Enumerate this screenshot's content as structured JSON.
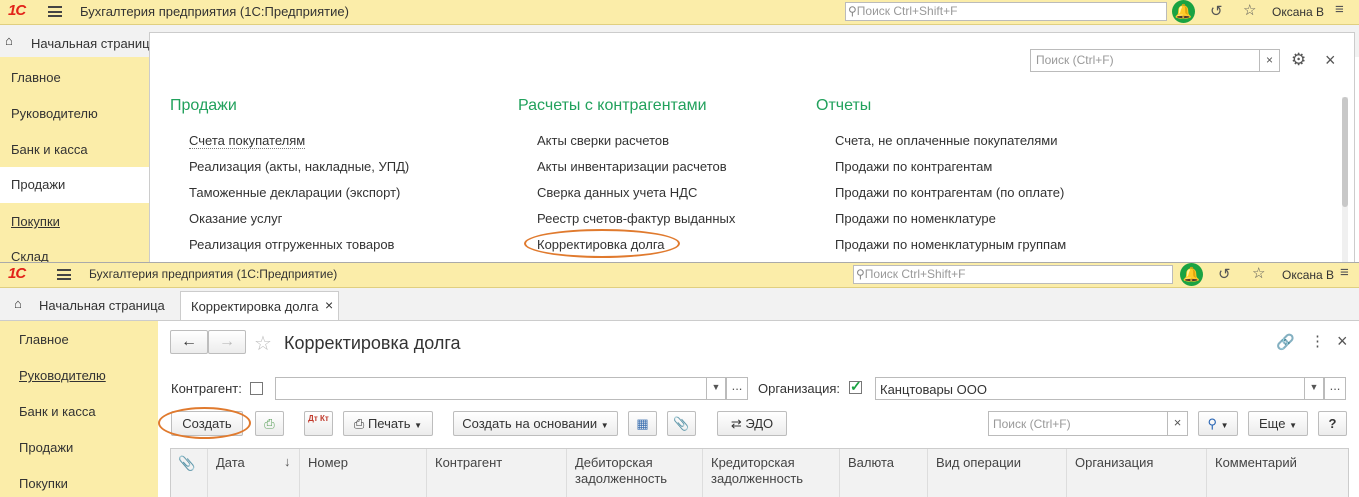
{
  "top": {
    "logo": "1С",
    "title": "Бухгалтерия предприятия  (1С:Предприятие)",
    "search_placeholder": "Поиск Ctrl+Shift+F",
    "user": "Оксана В",
    "home_tab": "Начальная страница",
    "sidebar": [
      "Главное",
      "Руководителю",
      "Банк и касса",
      "Продажи",
      "Покупки",
      "Склад"
    ],
    "panel_search_placeholder": "Поиск (Ctrl+F)",
    "sections": [
      {
        "title": "Продажи",
        "items": [
          "Счета покупателям",
          "Реализация (акты, накладные, УПД)",
          "Таможенные декларации (экспорт)",
          "Оказание услуг",
          "Реализация отгруженных товаров"
        ]
      },
      {
        "title": "Расчеты с контрагентами",
        "items": [
          "Акты сверки расчетов",
          "Акты инвентаризации расчетов",
          "Сверка данных учета НДС",
          "Реестр счетов-фактур выданных",
          "Корректировка долга"
        ]
      },
      {
        "title": "Отчеты",
        "items": [
          "Счета, не оплаченные покупателями",
          "Продажи по контрагентам",
          "Продажи по контрагентам (по оплате)",
          "Продажи по номенклатуре",
          "Продажи по номенклатурным группам"
        ]
      }
    ]
  },
  "bottom": {
    "logo": "1С",
    "title": "Бухгалтерия предприятия  (1С:Предприятие)",
    "search_placeholder": "Поиск Ctrl+Shift+F",
    "user": "Оксана В",
    "home_tab": "Начальная страница",
    "doc_tab": "Корректировка долга",
    "sidebar": [
      "Главное",
      "Руководителю",
      "Банк и касса",
      "Продажи",
      "Покупки"
    ],
    "form_title": "Корректировка долга",
    "contragent_label": "Контрагент:",
    "organization_label": "Организация:",
    "organization_value": "Канцтовары ООО",
    "create_btn": "Создать",
    "dtkt": "Дт Кт",
    "print_btn": "Печать",
    "create_based_btn": "Создать на основании",
    "edo_btn": "ЭДО",
    "search_placeholder_list": "Поиск (Ctrl+F)",
    "more_btn": "Еще",
    "help_btn": "?",
    "columns": [
      {
        "l1": "Дата",
        "l2": ""
      },
      {
        "l1": "Номер",
        "l2": ""
      },
      {
        "l1": "Контрагент",
        "l2": ""
      },
      {
        "l1": "Дебиторская",
        "l2": "задолженность"
      },
      {
        "l1": "Кредиторская",
        "l2": "задолженность"
      },
      {
        "l1": "Валюта",
        "l2": ""
      },
      {
        "l1": "Вид операции",
        "l2": ""
      },
      {
        "l1": "Организация",
        "l2": ""
      },
      {
        "l1": "Комментарий",
        "l2": ""
      }
    ]
  }
}
